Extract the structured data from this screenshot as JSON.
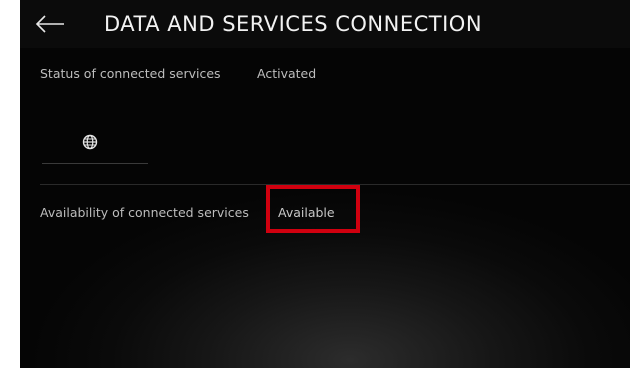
{
  "header": {
    "title": "DATA AND SERVICES CONNECTION",
    "back_icon": "arrow-left-icon"
  },
  "status": {
    "label": "Status of connected services",
    "value": "Activated"
  },
  "tab": {
    "icon": "globe-icon"
  },
  "availability": {
    "label": "Availability of connected services",
    "value": "Available"
  },
  "colors": {
    "background": "#0a0a0a",
    "text": "#bdbdbd",
    "title": "#f2f2f2",
    "highlight": "#d0000f"
  }
}
